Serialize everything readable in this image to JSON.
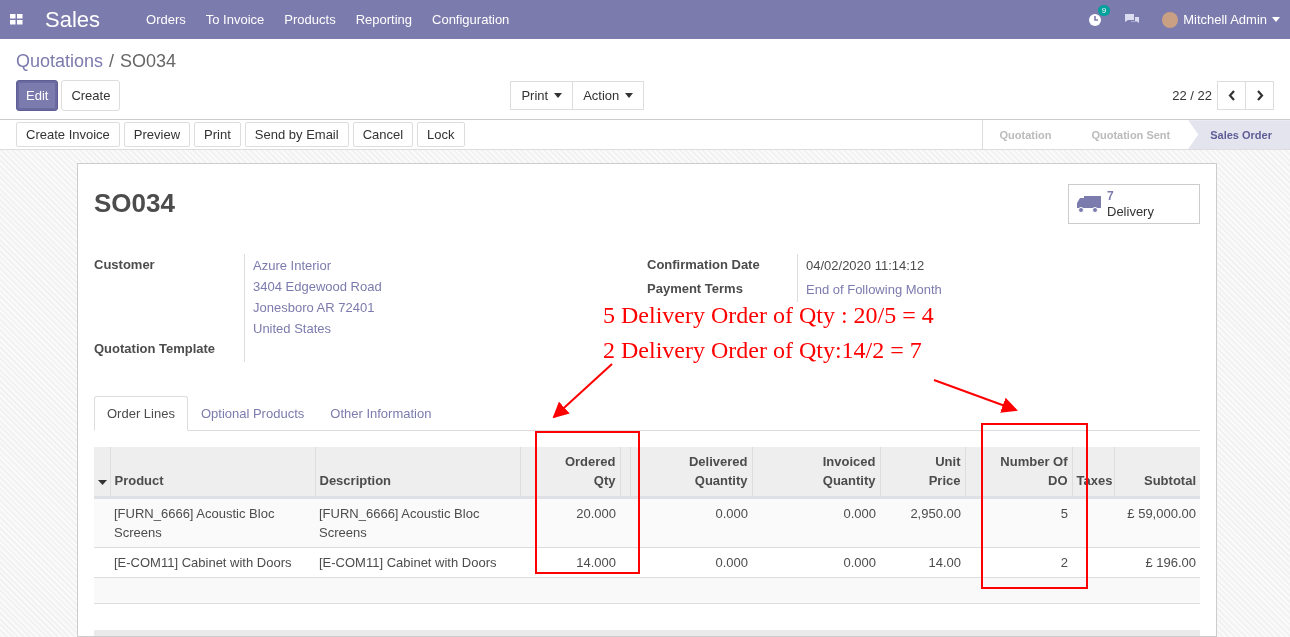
{
  "navbar": {
    "app": "Sales",
    "menu": [
      "Orders",
      "To Invoice",
      "Products",
      "Reporting",
      "Configuration"
    ],
    "activity_count": "9",
    "user": "Mitchell Admin"
  },
  "breadcrumb": {
    "parent": "Quotations",
    "separator": "/",
    "current": "SO034"
  },
  "buttons": [
    {
      "label": "Edit",
      "primary": true
    },
    {
      "label": "Create",
      "primary": false
    }
  ],
  "dropdowns": [
    "Print",
    "Action"
  ],
  "pager": "22 / 22",
  "actions": [
    "Create Invoice",
    "Preview",
    "Print",
    "Send by Email",
    "Cancel",
    "Lock"
  ],
  "stages": [
    {
      "label": "Quotation",
      "selected": false
    },
    {
      "label": "Quotation Sent",
      "selected": false
    },
    {
      "label": "Sales Order",
      "selected": true
    }
  ],
  "sheet": {
    "title": "SO034",
    "smart_button": {
      "count": "7",
      "label": "Delivery"
    },
    "left_fields": [
      {
        "label": "Customer",
        "values": [
          "Azure Interior",
          "3404 Edgewood Road",
          "Jonesboro AR 72401",
          "United States"
        ],
        "link": true
      },
      {
        "label": "Quotation Template"
      }
    ],
    "right_fields": [
      {
        "label": "Confirmation Date",
        "value": "04/02/2020 11:14:12",
        "link": false
      },
      {
        "label": "Payment Terms",
        "value": "End of Following Month",
        "link": true
      }
    ],
    "tabs": [
      {
        "label": "Order Lines",
        "selected": true
      },
      {
        "label": "Optional Products",
        "selected": false
      },
      {
        "label": "Other Information",
        "selected": false
      }
    ],
    "table": {
      "columns": [
        "Product",
        "Description",
        "Ordered Qty",
        "Delivered Quantity",
        "Invoiced Quantity",
        "Unit Price",
        "Number Of DO",
        "Taxes",
        "Subtotal"
      ],
      "rows": [
        [
          "[FURN_6666] Acoustic Bloc Screens",
          "[FURN_6666] Acoustic Bloc Screens",
          "20.000",
          "0.000",
          "0.000",
          "2,950.00",
          "5",
          null,
          "£ 59,000.00"
        ],
        [
          "[E-COM11] Cabinet with Doors",
          "[E-COM11] Cabinet with Doors",
          "14.000",
          "0.000",
          "0.000",
          "14.00",
          "2",
          null,
          "£ 196.00"
        ]
      ]
    }
  },
  "annotations": [
    "5 Delivery Order of Qty : 20/5 = 4",
    "2 Delivery Order of Qty:14/2 = 7"
  ]
}
